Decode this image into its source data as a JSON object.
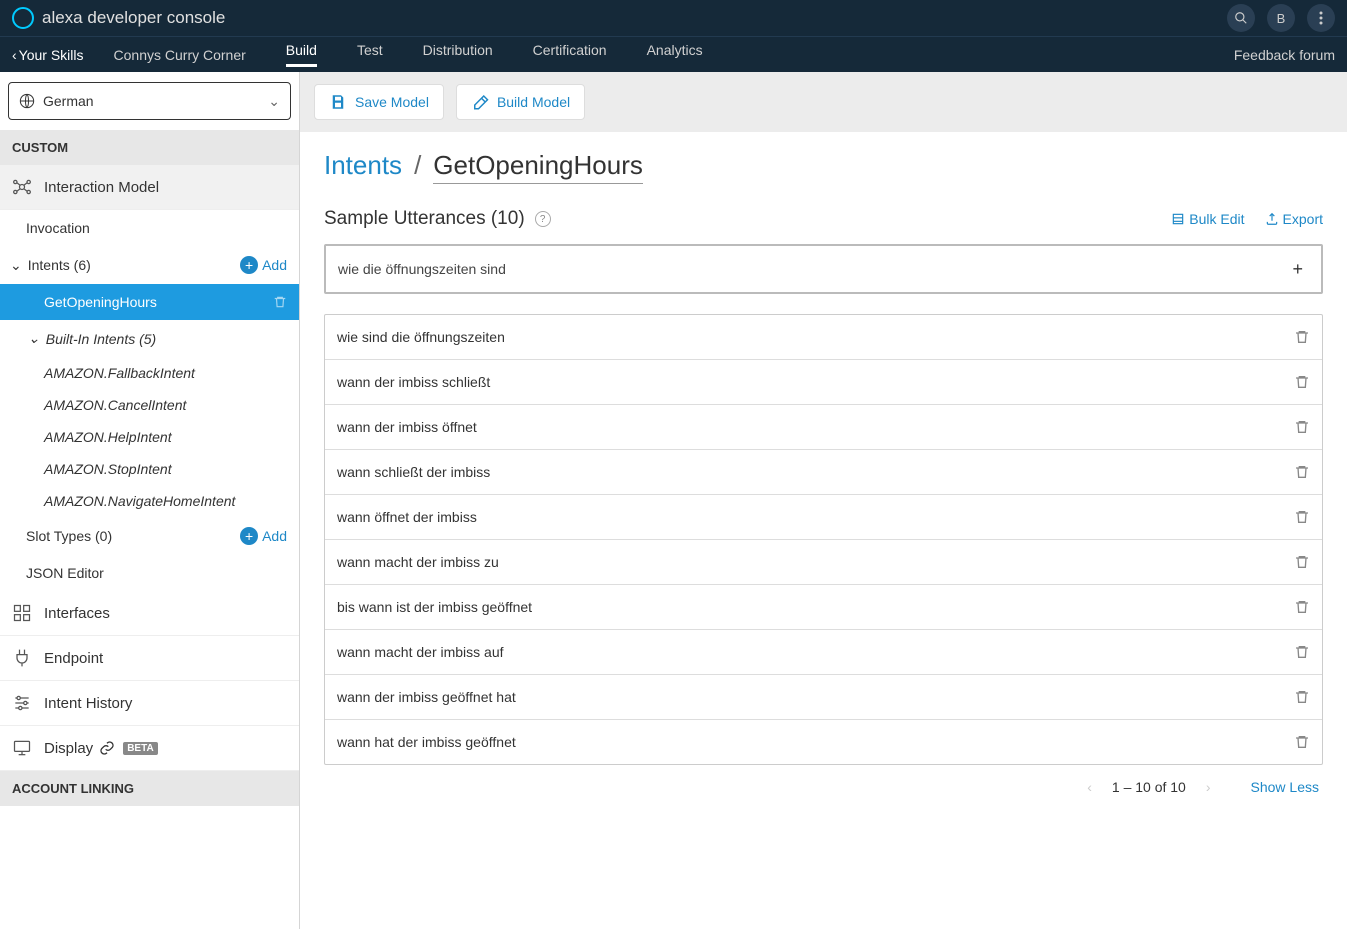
{
  "header": {
    "title": "alexa developer console",
    "avatar_initial": "B"
  },
  "subnav": {
    "back_label": "Your Skills",
    "skill_name": "Connys Curry Corner",
    "tabs": [
      "Build",
      "Test",
      "Distribution",
      "Certification",
      "Analytics"
    ],
    "active_tab": "Build",
    "feedback": "Feedback forum"
  },
  "sidebar": {
    "language": "German",
    "section_custom": "CUSTOM",
    "interaction_model": "Interaction Model",
    "invocation": "Invocation",
    "intents_label": "Intents (6)",
    "add_label": "Add",
    "selected_intent": "GetOpeningHours",
    "builtin_label": "Built-In Intents (5)",
    "builtin_items": [
      "AMAZON.FallbackIntent",
      "AMAZON.CancelIntent",
      "AMAZON.HelpIntent",
      "AMAZON.StopIntent",
      "AMAZON.NavigateHomeIntent"
    ],
    "slot_types": "Slot Types (0)",
    "json_editor": "JSON Editor",
    "interfaces": "Interfaces",
    "endpoint": "Endpoint",
    "intent_history": "Intent History",
    "display": "Display",
    "beta": "BETA",
    "account_linking": "ACCOUNT LINKING"
  },
  "toolbar": {
    "save": "Save Model",
    "build": "Build Model"
  },
  "breadcrumb": {
    "root": "Intents",
    "sep": "/",
    "current": "GetOpeningHours"
  },
  "utterances": {
    "heading": "Sample Utterances (10)",
    "bulk_edit": "Bulk Edit",
    "export": "Export",
    "input_value": "wie die öffnungszeiten sind",
    "items": [
      "wie sind die öffnungszeiten",
      "wann der imbiss schließt",
      "wann der imbiss öffnet",
      "wann schließt der imbiss",
      "wann öffnet der imbiss",
      "wann macht der imbiss zu",
      "bis wann ist der imbiss geöffnet",
      "wann macht der imbiss auf",
      "wann der imbiss geöffnet hat",
      "wann hat der imbiss geöffnet"
    ]
  },
  "paging": {
    "text": "1 – 10 of 10",
    "show_less": "Show Less"
  }
}
